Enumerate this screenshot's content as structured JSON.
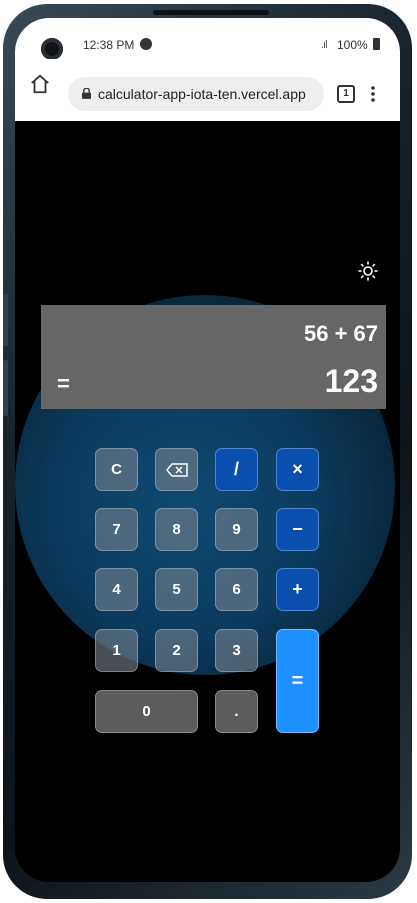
{
  "status_bar": {
    "time": "12:38 PM",
    "battery": "100%"
  },
  "browser": {
    "url": "calculator-app-iota-ten.vercel.app",
    "tab_count": "1"
  },
  "calculator": {
    "expression": "56 + 67",
    "equals": "=",
    "result": "123",
    "keys": {
      "clear": "C",
      "backspace": "⌫",
      "divide": "/",
      "multiply": "×",
      "seven": "7",
      "eight": "8",
      "nine": "9",
      "minus": "−",
      "four": "4",
      "five": "5",
      "six": "6",
      "plus": "+",
      "one": "1",
      "two": "2",
      "three": "3",
      "equals": "=",
      "zero": "0",
      "dot": "."
    }
  },
  "colors": {
    "operator_key": "#0a4fb0",
    "equals_key": "#1e90ff",
    "display_bg": "#666666",
    "glow": "#0b3b5e"
  },
  "icons": [
    "home-icon",
    "lock-icon",
    "tabs-icon",
    "menu-icon",
    "theme-toggle-icon",
    "spotify-icon",
    "signal-icon",
    "battery-icon"
  ]
}
